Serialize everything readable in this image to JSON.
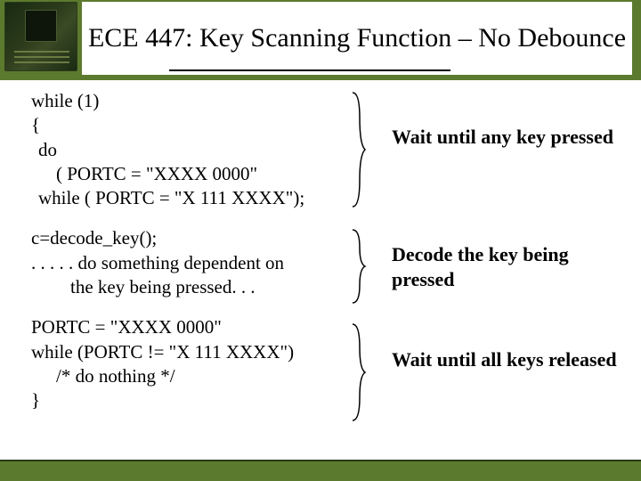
{
  "title": "ECE 447: Key Scanning Function – No Debounce",
  "code": {
    "block1": {
      "l1": "while (1)",
      "l2": "{",
      "l3": "do",
      "l4": "( PORTC = \"XXXX 0000\"",
      "l5": "while ( PORTC = \"X 111 XXXX\");"
    },
    "block2": {
      "l1": "c=decode_key();",
      "l2": ". . . . . do something dependent on",
      "l3": "the key being pressed. . ."
    },
    "block3": {
      "l1": "PORTC = \"XXXX 0000\"",
      "l2": "while (PORTC != \"X 111 XXXX\")",
      "l3": "/* do nothing */",
      "l4": "}"
    }
  },
  "annotations": {
    "a1": "Wait until any key pressed",
    "a2": "Decode the key being pressed",
    "a3": "Wait until all keys released"
  }
}
